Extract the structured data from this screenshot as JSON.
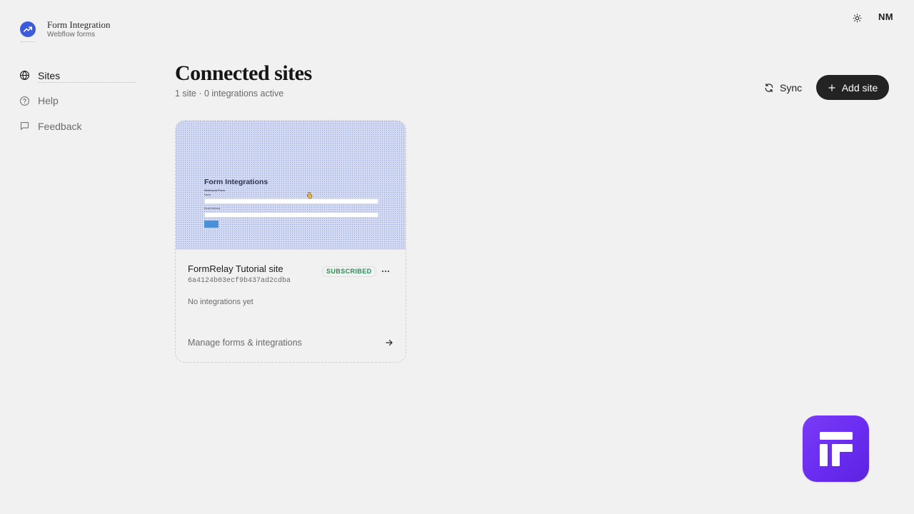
{
  "brand": {
    "name": "Form Integration",
    "subtitle": "Webflow forms",
    "logo_icon": "trend-line-icon",
    "logo_color": "#3b5bdb"
  },
  "header": {
    "theme_icon": "sun-icon",
    "user_initials": "NM"
  },
  "sidebar": {
    "items": [
      {
        "label": "Sites",
        "icon": "globe-icon",
        "active": true
      },
      {
        "label": "Help",
        "icon": "help-circle-icon",
        "active": false
      },
      {
        "label": "Feedback",
        "icon": "message-square-icon",
        "active": false
      }
    ]
  },
  "main": {
    "title": "Connected sites",
    "subtitle": "1 site · 0 integrations active",
    "sync_label": "Sync",
    "add_label": "Add site"
  },
  "site_card": {
    "name": "FormRelay Tutorial site",
    "id": "6a4124b03ecf9b437ad2cdba",
    "status": "SUBSCRIBED",
    "status_color": "#2e8b57",
    "empty_text": "No integrations yet",
    "link_label": "Manage forms & integrations",
    "preview": {
      "title": "Form Integrations",
      "subtitle": "Webhook Form",
      "field_1_label": "Name",
      "field_2_label": "Email Address"
    }
  },
  "colors": {
    "background": "#f1f1f1",
    "primary_button": "#232323",
    "app_badge": "#6a2cf0"
  }
}
